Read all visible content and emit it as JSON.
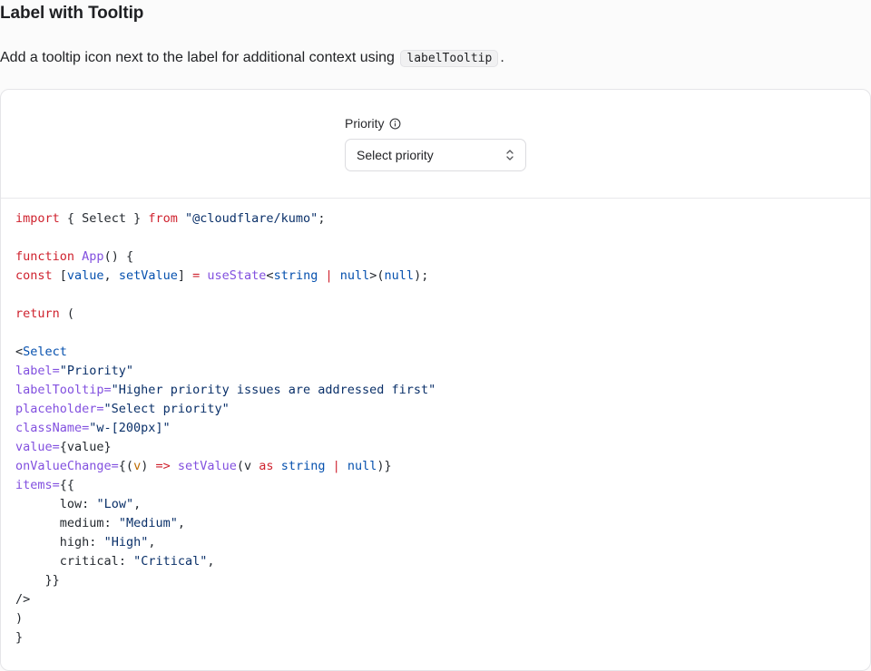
{
  "heading": "Label with Tooltip",
  "description": {
    "before": "Add a tooltip icon next to the label for additional context using ",
    "code": "labelTooltip",
    "after": "."
  },
  "preview": {
    "label": "Priority",
    "tooltip_icon": "info-icon",
    "select_placeholder": "Select priority",
    "select_icon": "chevron-up-down-icon"
  },
  "code_snippet": {
    "import_names": "{ Select }",
    "import_source": "\"@cloudflare/kumo\"",
    "fn_name": "App",
    "state_value": "value",
    "state_setter": "setValue",
    "state_hook": "useState",
    "state_type": "string",
    "state_null": "null",
    "component": "Select",
    "label_value": "\"Priority\"",
    "tooltip_value": "\"Higher priority issues are addressed first\"",
    "placeholder_value": "\"Select priority\"",
    "classname_value": "\"w-[200px]\"",
    "items": [
      {
        "key": "low",
        "value": "\"Low\""
      },
      {
        "key": "medium",
        "value": "\"Medium\""
      },
      {
        "key": "high",
        "value": "\"High\""
      },
      {
        "key": "critical",
        "value": "\"Critical\""
      }
    ]
  }
}
